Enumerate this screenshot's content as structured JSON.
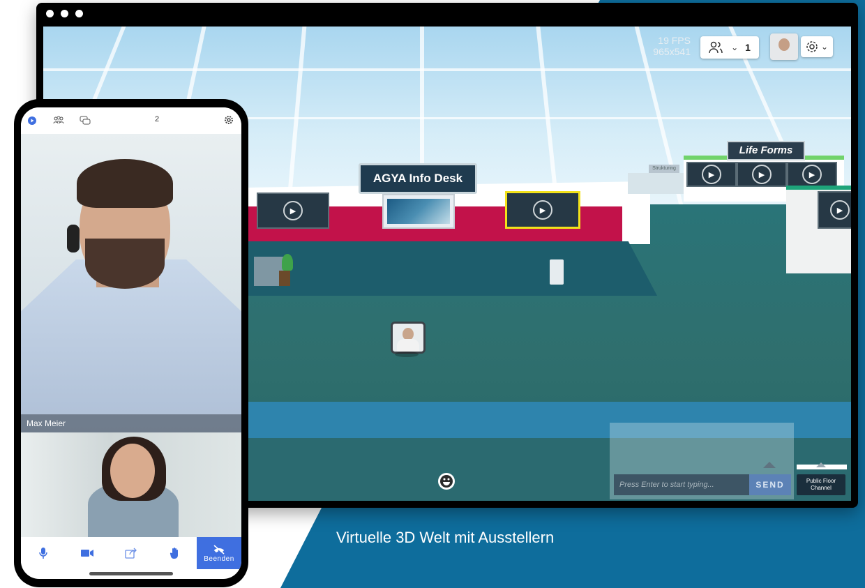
{
  "caption": "Virtuelle 3D Welt mit Ausstellern",
  "world": {
    "fps": "19 FPS",
    "resolution": "965x541",
    "participants_count": "1",
    "info_desk_sign": "AGYA Info Desk",
    "life_forms_sign": "Life Forms",
    "small_booth_sign": "Strukturing",
    "chat_placeholder": "Press Enter to start typing...",
    "send_label": "SEND",
    "channel_label": "Public Floor Channel"
  },
  "phone": {
    "participant_count": "2",
    "main_participant_name": "Max Meier",
    "end_label": "Beenden"
  },
  "colors": {
    "backdrop": "#0e6d9c",
    "desk_accent": "#c2124a",
    "end_button": "#3f6fe0",
    "send_button": "#5c82b6"
  }
}
